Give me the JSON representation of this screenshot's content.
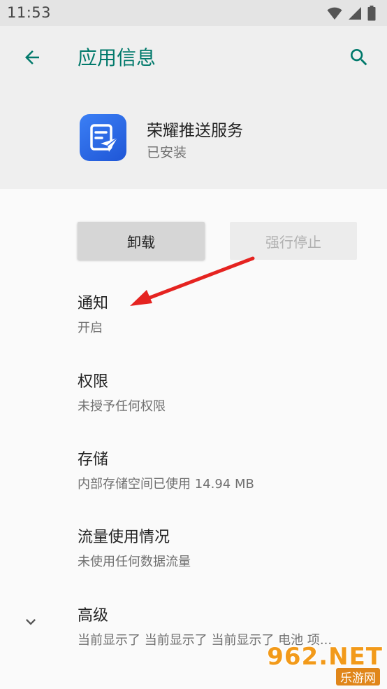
{
  "status_bar": {
    "time": "11:53"
  },
  "header": {
    "title": "应用信息",
    "back_icon": "arrow-left-icon",
    "search_icon": "search-icon",
    "accent_color": "#00796b"
  },
  "app": {
    "name": "荣耀推送服务",
    "status": "已安装",
    "icon": "push-service-icon",
    "icon_color": "#2f6ae8"
  },
  "buttons": {
    "uninstall": "卸载",
    "force_stop": "强行停止"
  },
  "items": [
    {
      "title": "通知",
      "subtitle": "开启"
    },
    {
      "title": "权限",
      "subtitle": "未授予任何权限"
    },
    {
      "title": "存储",
      "subtitle": "内部存储空间已使用 14.94 MB"
    },
    {
      "title": "流量使用情况",
      "subtitle": "未使用任何数据流量"
    },
    {
      "title": "高级",
      "subtitle": "当前显示了 当前显示了 当前显示了 电池 项..."
    }
  ],
  "watermark": {
    "brand": "962.NET",
    "sub": "乐游网"
  }
}
